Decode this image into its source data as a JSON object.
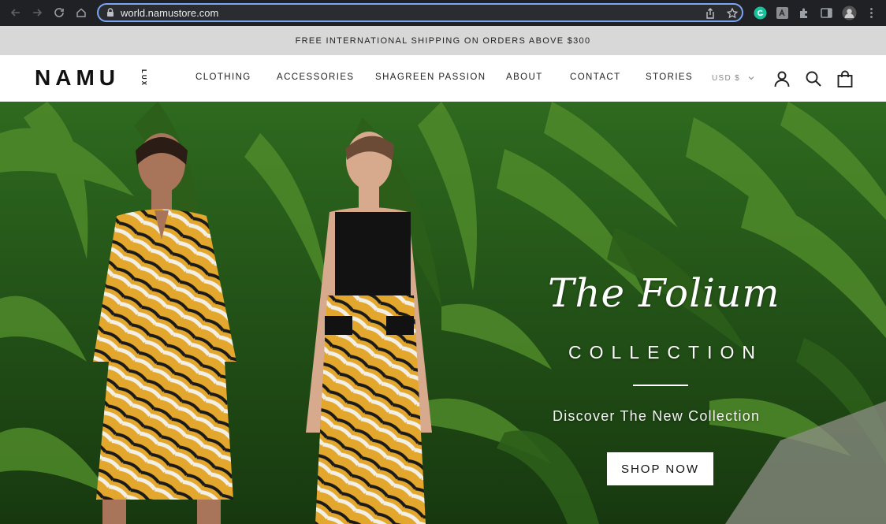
{
  "browser": {
    "url": "world.namustore.com"
  },
  "announcement": {
    "text": "FREE INTERNATIONAL SHIPPING ON ORDERS ABOVE $300"
  },
  "header": {
    "logo_text": "NAMU",
    "logo_suffix": "LUX",
    "menu": [
      "CLOTHING",
      "ACCESSORIES",
      "SHAGREEN PASSION",
      "ABOUT",
      "CONTACT",
      "STORIES"
    ],
    "currency": "USD $"
  },
  "hero": {
    "script_title": "The Folium",
    "collection_word": "COLLECTION",
    "subtitle": "Discover The New Collection",
    "cta_label": "SHOP NOW"
  },
  "colors": {
    "chrome_bg": "#202124",
    "omnibox_border": "#7aa6f5",
    "announcement_bg": "#d8d8d8",
    "foliage_dark": "#1f4a17",
    "foliage_light": "#4f8a2a",
    "dress_yellow": "#e3a72e"
  },
  "icons": [
    "back-icon",
    "forward-icon",
    "reload-icon",
    "home-icon",
    "lock-icon",
    "share-icon",
    "bookmark-star-icon",
    "grammarly-icon",
    "extension-icon",
    "puzzle-icon",
    "side-panel-icon",
    "profile-avatar-icon",
    "kebab-menu-icon",
    "account-icon",
    "search-icon",
    "bag-icon",
    "chevron-down-icon"
  ]
}
